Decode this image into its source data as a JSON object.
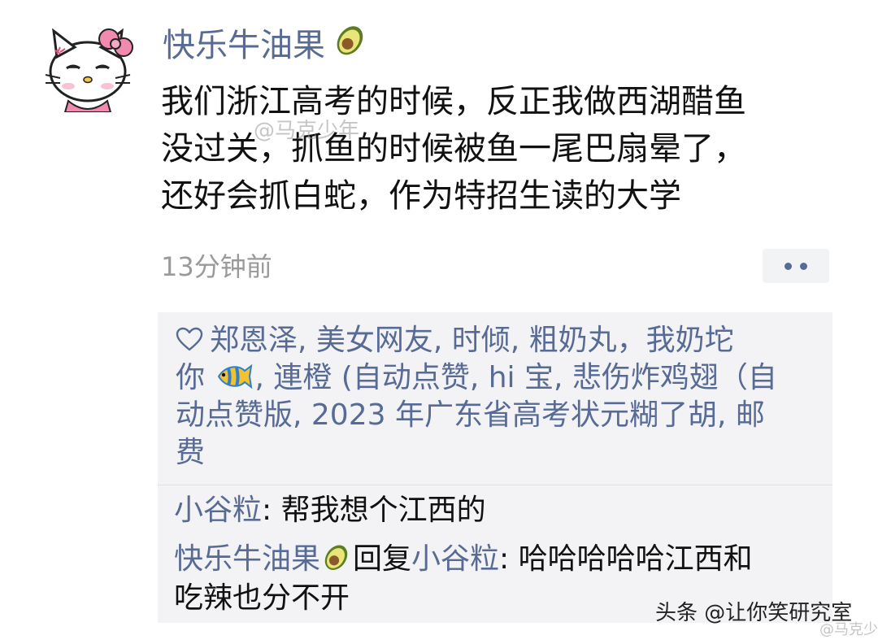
{
  "post": {
    "author": "快乐牛油果",
    "author_emoji": "avocado-icon",
    "text_lines": [
      "我们浙江高考的时候，反正我做西湖醋鱼",
      "没过关，抓鱼的时候被鱼一尾巴扇晕了，",
      "还好会抓白蛇，作为特招生读的大学"
    ],
    "watermark": "@马克少年",
    "timestamp": "13分钟前"
  },
  "likes": {
    "heart_icon": "heart-outline-icon",
    "line1": "郑恩泽, 美女网友, 时倾, 粗奶丸，我奶坨",
    "line2_prefix": "你",
    "line2_emoji": "tropical-fish-icon",
    "line2_rest": ", 連橙 (自动点赞, hi 宝, 悲伤炸鸡翅（自",
    "line3": "动点赞版, 2023 年广东省高考状元糊了胡, 邮",
    "line4": "费"
  },
  "comments": [
    {
      "name": "小谷粒",
      "text": ": 帮我想个江西的"
    },
    {
      "name": "快乐牛油果",
      "reply_word": "回复",
      "reply_to": "小谷粒",
      "text_line1": ": 哈哈哈哈哈江西和",
      "text_line2": "吃辣也分不开"
    }
  ],
  "footer": {
    "watermark": "头条 @让你笑研究室",
    "faint": "@马克少年"
  },
  "colors": {
    "link_blue": "#576b95",
    "text": "#111111",
    "muted": "#9a9a9a",
    "panel_bg": "#f3f3f5"
  }
}
